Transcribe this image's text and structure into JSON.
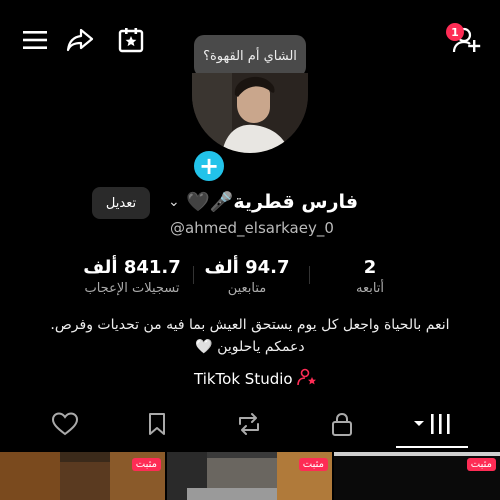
{
  "top_bar": {
    "notification_count": "1",
    "icons": [
      "menu-icon",
      "share-icon",
      "calendar-star-icon",
      "add-friend-icon"
    ]
  },
  "bubble_text": "الشاي أم القهوة؟",
  "profile": {
    "edit_label": "تعديل",
    "name": "فارس قطرية🎤🖤",
    "handle": "@ahmed_elsarkaey_0"
  },
  "stats": [
    {
      "value": "841.7 ألف",
      "label": "تسجيلات الإعجاب"
    },
    {
      "value": "94.7 ألف",
      "label": "متابعين"
    },
    {
      "value": "2",
      "label": "أتابعه"
    }
  ],
  "bio": {
    "line1": "انعم بالحياة واجعل كل يوم يستحق العيش بما فيه من تحديات وفرص.",
    "line2": "دعمكم ياحلوين 🤍"
  },
  "studio_label": "TikTok Studio",
  "tabs": [
    "likes-tab",
    "saved-tab",
    "reposts-tab",
    "private-tab",
    "videos-tab"
  ],
  "thumbnails": [
    {
      "pin": "مثبت"
    },
    {
      "pin": "مثبت"
    },
    {
      "pin": "مثبت"
    }
  ],
  "colors": {
    "accent": "#fe2c55",
    "plus": "#22c3ea"
  }
}
